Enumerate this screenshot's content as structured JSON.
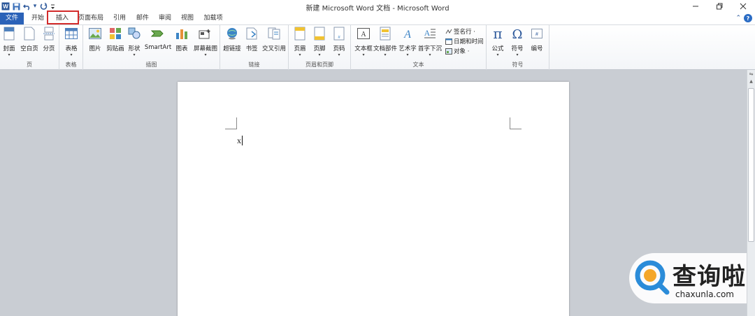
{
  "window": {
    "title": "新建 Microsoft Word 文档 - Microsoft Word",
    "qat": [
      "word-app-icon",
      "save-icon",
      "undo-icon",
      "dropdown-icon",
      "redo-icon",
      "customize-icon"
    ],
    "controls": [
      "minimize-icon",
      "restore-icon",
      "close-icon"
    ]
  },
  "tabs": {
    "file": "文件",
    "items": [
      "开始",
      "插入",
      "页面布局",
      "引用",
      "邮件",
      "审阅",
      "视图",
      "加载项"
    ],
    "active": "插入",
    "highlight_color": "#d22a2a"
  },
  "ribbon": {
    "groups": [
      {
        "label": "页",
        "buttons": [
          "封面",
          "空白页",
          "分页"
        ]
      },
      {
        "label": "表格",
        "buttons": [
          "表格"
        ]
      },
      {
        "label": "插图",
        "buttons": [
          "图片",
          "剪贴画",
          "形状",
          "SmartArt",
          "图表",
          "屏幕截图"
        ]
      },
      {
        "label": "链接",
        "buttons": [
          "超链接",
          "书签",
          "交叉引用"
        ]
      },
      {
        "label": "页眉和页脚",
        "buttons": [
          "页眉",
          "页脚",
          "页码"
        ]
      },
      {
        "label": "文本",
        "buttons": [
          "文本框",
          "文档部件",
          "艺术字",
          "首字下沉"
        ],
        "small": [
          "签名行 ·",
          "日期和时间",
          "对象 ·"
        ]
      },
      {
        "label": "符号",
        "buttons": [
          "公式",
          "符号",
          "编号"
        ]
      }
    ]
  },
  "document": {
    "text": "x"
  },
  "watermark": {
    "brand_cn": "查询啦",
    "url": "chaxunla.com",
    "brand_color": "#2b8cd9"
  },
  "colors": {
    "file_tab": "#2b62b8",
    "doc_background": "#c9cdd3"
  }
}
